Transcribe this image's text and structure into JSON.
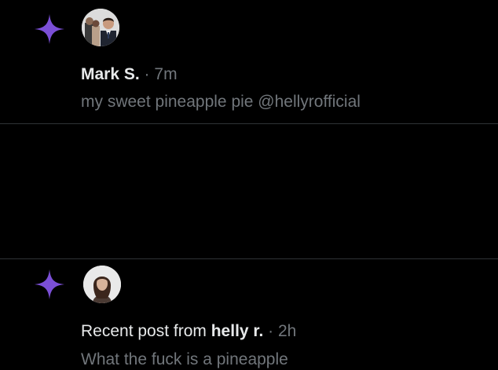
{
  "colors": {
    "background": "#000000",
    "text_primary": "#e7e9ea",
    "text_secondary": "#71767b",
    "divider": "#2f3336",
    "sparkle_purple": "#7b4fd6"
  },
  "notifications": [
    {
      "icon": "sparkle-icon",
      "author": "Mark S.",
      "separator": "·",
      "time": "7m",
      "text": "my sweet pineapple pie @hellyrofficial"
    },
    {
      "icon": "sparkle-icon",
      "prefix": "Recent post from ",
      "author": "helly r.",
      "separator": "·",
      "time": "2h",
      "text": "What the fuck is a pineapple"
    }
  ]
}
